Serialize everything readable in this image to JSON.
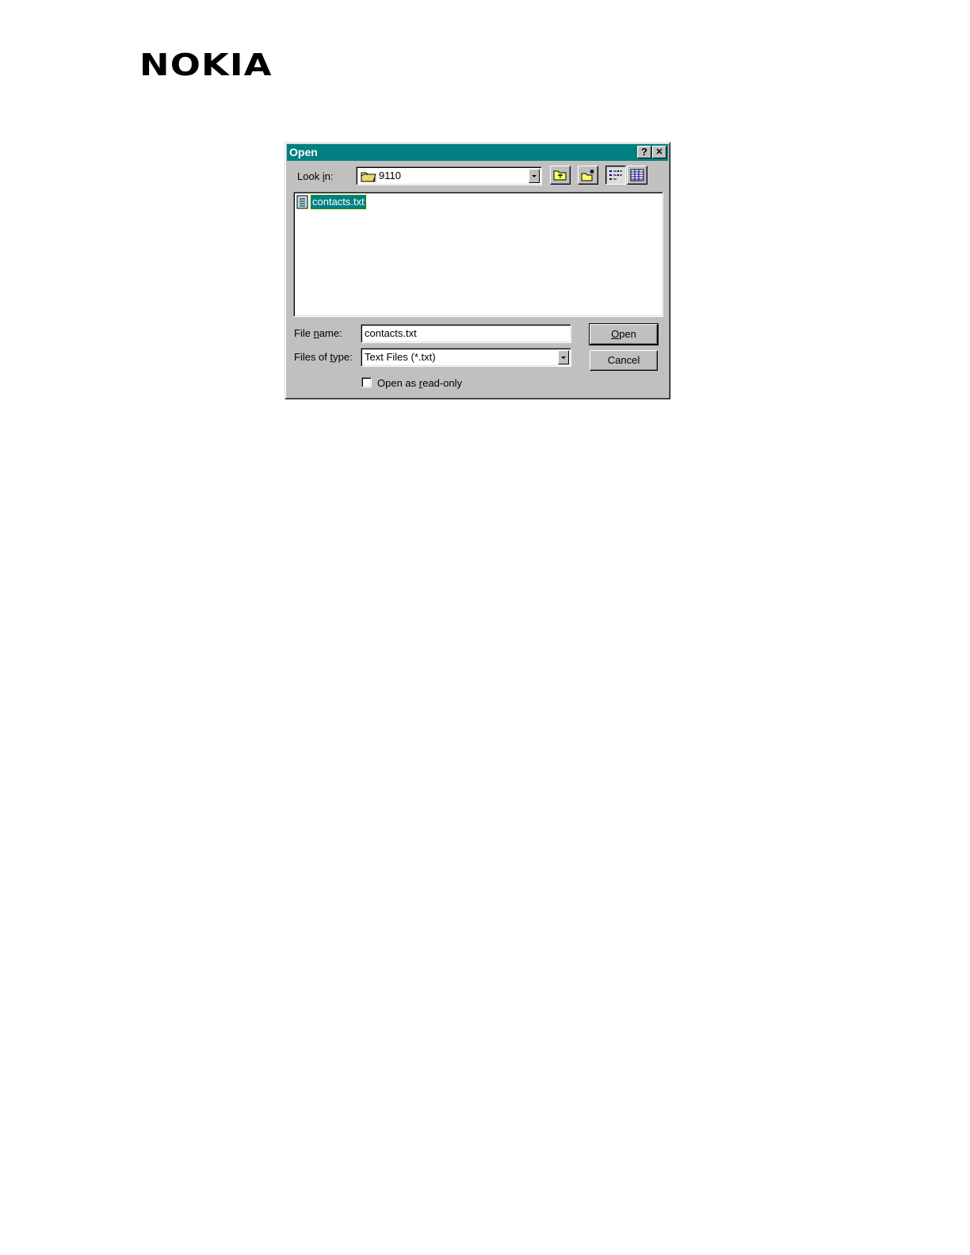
{
  "logo": {
    "text": "NOKIA"
  },
  "dialog": {
    "title": "Open",
    "help_button": "?",
    "close_button": "✕",
    "look_in": {
      "label_pre": "Look ",
      "label_key": "i",
      "label_post": "n:",
      "value": "9110"
    },
    "file_list": [
      {
        "name": "contacts.txt",
        "selected": true
      }
    ],
    "file_name": {
      "label_pre": "File ",
      "label_key": "n",
      "label_post": "ame:",
      "value": "contacts.txt"
    },
    "files_of_type": {
      "label_pre": "Files of ",
      "label_key": "t",
      "label_post": "ype:",
      "value": "Text Files (*.txt)"
    },
    "open_button": {
      "key": "O",
      "rest": "pen"
    },
    "cancel_button": "Cancel",
    "read_only": {
      "pre": "Open as ",
      "key": "r",
      "post": "ead-only",
      "checked": false
    }
  }
}
